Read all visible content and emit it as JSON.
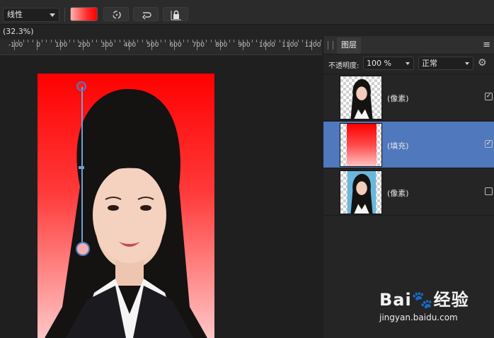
{
  "toolbar": {
    "gradient_type": "线性",
    "swatch_colors": [
      "#ffb1b1",
      "#ff0000"
    ],
    "buttons": [
      "rotate-icon",
      "undo-icon",
      "lock-icon"
    ]
  },
  "zoom_label": "(32.3%)",
  "ruler": {
    "labels": [
      "-100",
      "0",
      "100",
      "200",
      "300",
      "400",
      "500",
      "600",
      "700",
      "800",
      "900",
      "1000",
      "1100",
      "1200"
    ]
  },
  "layers_panel": {
    "tab_label": "图层",
    "opacity_label": "不透明度:",
    "opacity_value": "100 %",
    "blend_mode": "正常",
    "layers": [
      {
        "name": "(像素)",
        "checked": true,
        "selected": false
      },
      {
        "name": "(填充)",
        "checked": true,
        "selected": true
      },
      {
        "name": "(像素)",
        "checked": false,
        "selected": false
      }
    ]
  },
  "watermark": {
    "brand": "Bai",
    "brand_tail": "经验",
    "url": "jingyan.baidu.com"
  },
  "colors": {
    "gradient_start": "#ff0000",
    "gradient_end": "#ffc6c6",
    "selection": "#4f78bd"
  }
}
